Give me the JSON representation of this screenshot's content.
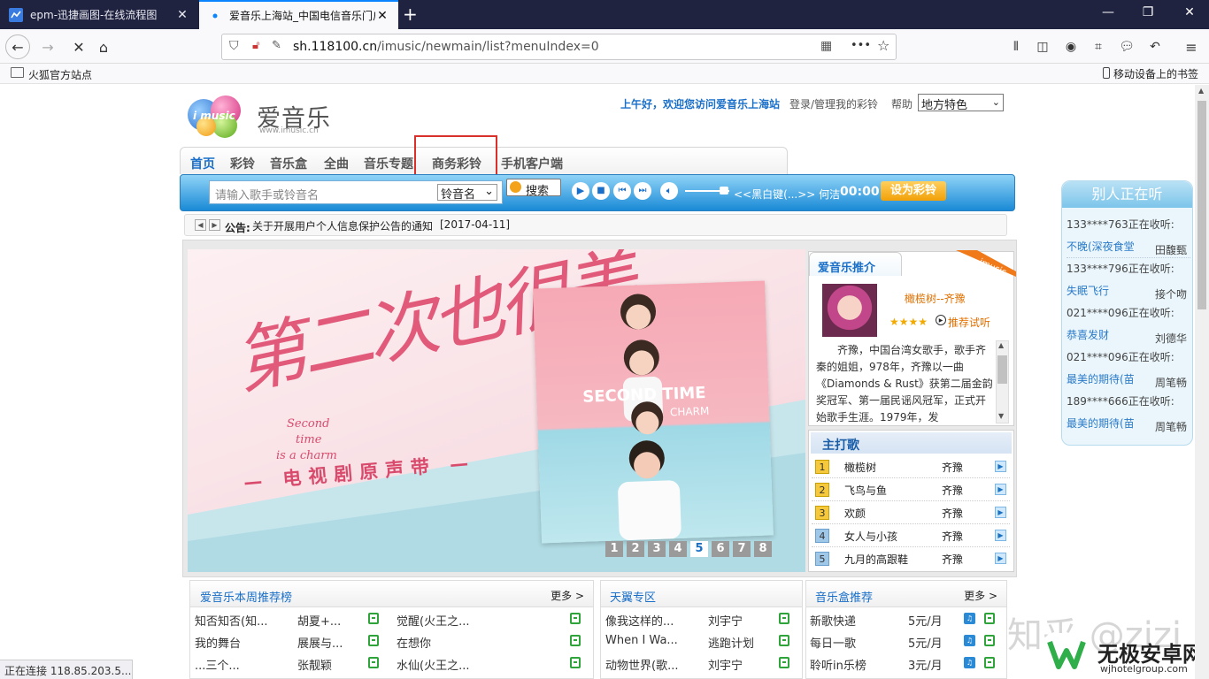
{
  "browser": {
    "tabs": [
      {
        "title": "epm-迅捷画图-在线流程图",
        "active": false
      },
      {
        "title": "爱音乐上海站_中国电信音乐门户",
        "active": true
      }
    ],
    "new_tab": "+",
    "url_host": "sh.118100.cn",
    "url_path": "/imusic/newmain/list?menuIndex=0",
    "url_more": "•••",
    "bookmarks_left": "火狐官方站点",
    "bookmarks_right": "移动设备上的书签",
    "status": "正在连接 118.85.203.5..."
  },
  "colors": {
    "accent": "#1a6fc8",
    "tab_bar": "#202340",
    "highlight_box": "#d9302c",
    "lyric_orange": "#e07000"
  },
  "header": {
    "logo_text": "爱音乐",
    "logo_sub": "www.imusic.cn",
    "logo_badge": "i music",
    "greeting": "上午好，欢迎您访问爱音乐上海站",
    "login": "登录/管理我的彩铃",
    "help": "帮助",
    "region_select": "地方特色"
  },
  "nav": {
    "items": [
      "首页",
      "彩铃",
      "音乐盒",
      "全曲",
      "音乐专题",
      "商务彩铃",
      "手机客户端"
    ],
    "highlighted": "商务彩铃"
  },
  "search": {
    "placeholder": "请输入歌手或铃音名",
    "type": "铃音名",
    "button": "搜索",
    "now_playing": "<<黑白键(...>> 何洁",
    "time": "00:00",
    "set_ring": "设为彩铃"
  },
  "notice": {
    "label": "公告:",
    "text": "关于开展用户个人信息保护公告的通知",
    "date": "[2017-04-11]"
  },
  "banner": {
    "calligraphy": "第二次也很美",
    "en_line1": "Second",
    "en_line2": "time",
    "en_line3": "is a charm",
    "subtitle": "— 电视剧原声带 —",
    "poster_title": "SECOND TIME",
    "poster_sub": "CHARM",
    "pages": [
      "1",
      "2",
      "3",
      "4",
      "5",
      "6",
      "7",
      "8"
    ],
    "active_page": "5"
  },
  "recommend": {
    "title": "爱音乐推介",
    "ribbon": "imusic",
    "song": "橄榄树--齐豫",
    "trial": "推荐试听",
    "stars": "★★★★",
    "bio": "齐豫，中国台湾女歌手，歌手齐秦的姐姐，978年，齐豫以一曲《Diamonds & Rust》获第二届金韵奖冠军、第一届民谣风冠军，正式开始歌手生涯。1979年，发"
  },
  "hits": {
    "title": "主打歌",
    "rows": [
      {
        "no": "1",
        "song": "橄榄树",
        "artist": "齐豫"
      },
      {
        "no": "2",
        "song": "飞鸟与鱼",
        "artist": "齐豫"
      },
      {
        "no": "3",
        "song": "欢颜",
        "artist": "齐豫"
      },
      {
        "no": "4",
        "song": "女人与小孩",
        "artist": "齐豫"
      },
      {
        "no": "5",
        "song": "九月的高跟鞋",
        "artist": "齐豫"
      }
    ]
  },
  "listening": {
    "title": "别人正在听",
    "rows": [
      {
        "user": "133****763正在收听:",
        "song": "不晚(深夜食堂",
        "artist": "田馥甄"
      },
      {
        "user": "133****796正在收听:",
        "song": "失眠飞行",
        "artist": "接个吻"
      },
      {
        "user": "021****096正在收听:",
        "song": "恭喜发财",
        "artist": "刘德华"
      },
      {
        "user": "021****096正在收听:",
        "song": "最美的期待(苗",
        "artist": "周笔畅"
      },
      {
        "user": "189****666正在收听:",
        "song": "最美的期待(苗",
        "artist": "周笔畅"
      }
    ]
  },
  "weekly": {
    "title": "爱音乐本周推荐榜",
    "more": "更多 >",
    "left": [
      {
        "song": "知否知否(知...",
        "artist": "胡夏+..."
      },
      {
        "song": "我的舞台",
        "artist": "展展与..."
      },
      {
        "song": "...三个...",
        "artist": "张靓颖"
      }
    ],
    "right": [
      {
        "song": "觉醒(火王之..."
      },
      {
        "song": "在想你"
      },
      {
        "song": "水仙(火王之..."
      }
    ]
  },
  "tianyi": {
    "title": "天翼专区",
    "rows": [
      {
        "song": "像我这样的...",
        "artist": "刘宇宁"
      },
      {
        "song": "When I Wa...",
        "artist": "逃跑计划"
      },
      {
        "song": "动物世界(歌...",
        "artist": "刘宇宁"
      }
    ]
  },
  "musicbox": {
    "title": "音乐盒推荐",
    "more": "更多 >",
    "rows": [
      {
        "name": "新歌快递",
        "price": "5元/月"
      },
      {
        "name": "每日一歌",
        "price": "5元/月"
      },
      {
        "name": "聆听in乐榜",
        "price": "3元/月"
      }
    ]
  },
  "watermark": {
    "zhihu": "知乎 @zizi",
    "site": "无极安卓网",
    "site_url": "wjhotelgroup.com"
  }
}
